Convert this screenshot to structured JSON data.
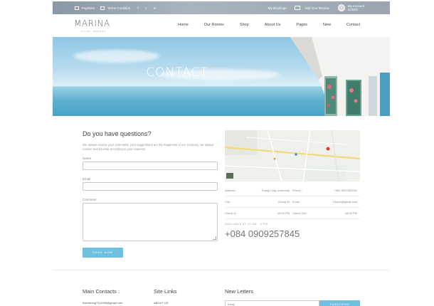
{
  "topbar": {
    "payment_label": "Payment",
    "terms_label": "Terms Condition",
    "social": [
      "f",
      "t",
      "in"
    ],
    "bookings_label": "My Bookings",
    "review_label": "Add Your Review",
    "account_label": "My Account",
    "login_label": "LOGIN"
  },
  "brand": {
    "name": "MARINA",
    "tagline": "HOTEL RESORT"
  },
  "menu": [
    "Home",
    "Our Rooms",
    "Shop",
    "About Us",
    "Pages",
    "New",
    "Contact"
  ],
  "hero": {
    "title": "CONTACT"
  },
  "contact_form": {
    "heading": "Do you have questions?",
    "description": "We always receive your comments, your suggestions are the happiness of our company, we always receive and develop according to your requests.",
    "name_label": "Name",
    "email_label": "Email",
    "comment_label": "Comment",
    "send_label": "SEND NOW"
  },
  "details": [
    {
      "label": "Address :",
      "value": "Thang Long University"
    },
    {
      "label": "Phone :",
      "value": "+084 0927852081"
    },
    {
      "label": "City :",
      "value": "Group IN"
    },
    {
      "label": "Email :",
      "value": "Hhphe@gmail.com"
    },
    {
      "label": "Check In :",
      "value": "15:00 PM"
    },
    {
      "label": "Check Out :",
      "value": "18:00 PM"
    }
  ],
  "availability": {
    "label": "AVAILABLE AT 10 AM - 9 PM",
    "phone": "+084 0909257845"
  },
  "footer": {
    "contacts_title": "Main Contacts :",
    "contacts_email": "thanhtrung7111999@gmail.com",
    "links_title": "Site Links",
    "links_first": "ABOUT US",
    "newsletter_title": "New Letters",
    "newsletter_placeholder": "Email",
    "subscribe_label": "SUBSCRIBE"
  },
  "colors": {
    "accent": "#6fc0df",
    "topbar": "#9aa5b0"
  }
}
